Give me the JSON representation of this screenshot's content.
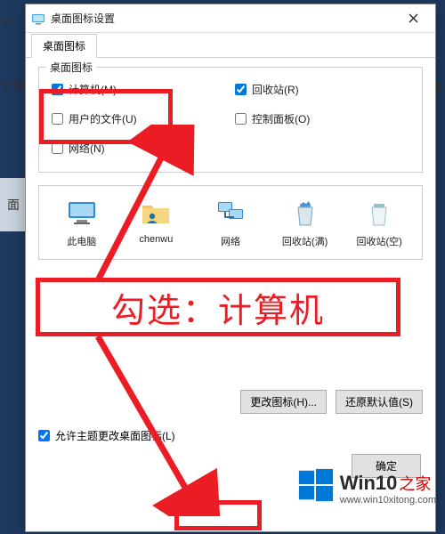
{
  "background": {
    "left_label": "设",
    "tab_label": "个性",
    "strip_label": "面",
    "right_label": "设置"
  },
  "dialog": {
    "title": "桌面图标设置",
    "tabs": [
      "桌面图标"
    ],
    "group_label": "桌面图标",
    "checkboxes": {
      "computer": {
        "label": "计算机(M)",
        "checked": true
      },
      "recycle": {
        "label": "回收站(R)",
        "checked": true
      },
      "userfiles": {
        "label": "用户的文件(U)",
        "checked": false
      },
      "ctrlpanel": {
        "label": "控制面板(O)",
        "checked": false
      },
      "network": {
        "label": "网络(N)",
        "checked": false
      }
    },
    "icons": [
      {
        "name": "thispc",
        "label": "此电脑"
      },
      {
        "name": "userfolder",
        "label": "chenwu"
      },
      {
        "name": "network",
        "label": "网络"
      },
      {
        "name": "recyclefull",
        "label": "回收站(满)"
      },
      {
        "name": "recycleempty",
        "label": "回收站(空)"
      }
    ],
    "buttons": {
      "change_icon": "更改图标(H)...",
      "restore": "还原默认值(S)",
      "ok": "确定"
    },
    "allow_themes": {
      "label": "允许主题更改桌面图标(L)",
      "checked": true
    }
  },
  "annotation": {
    "callout_text": "勾选：计算机"
  },
  "watermark": {
    "title": "Win10",
    "suffix": "之家",
    "url": "www.win10xitong.com"
  }
}
